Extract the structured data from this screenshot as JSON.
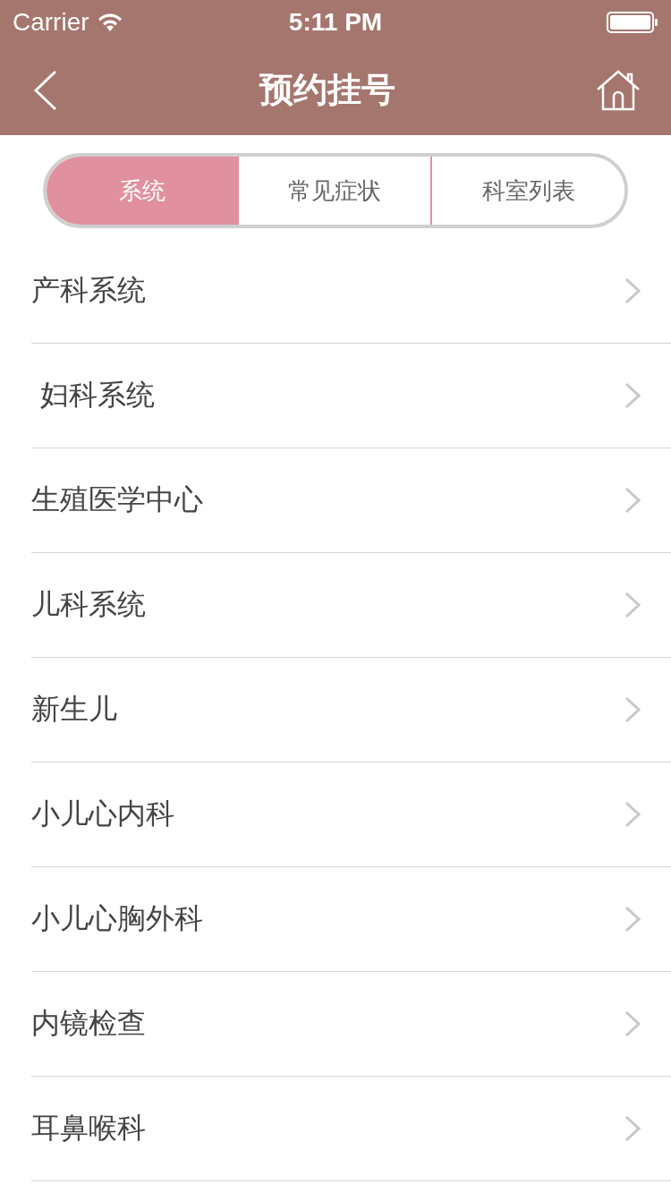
{
  "status_bar": {
    "carrier": "Carrier",
    "time": "5:11 PM"
  },
  "nav": {
    "title": "预约挂号"
  },
  "tabs": [
    {
      "label": "系统",
      "selected": true
    },
    {
      "label": "常见症状",
      "selected": false
    },
    {
      "label": "科室列表",
      "selected": false
    }
  ],
  "items": [
    {
      "label": "产科系统"
    },
    {
      "label": " 妇科系统"
    },
    {
      "label": "生殖医学中心"
    },
    {
      "label": "儿科系统"
    },
    {
      "label": "新生儿"
    },
    {
      "label": "小儿心内科"
    },
    {
      "label": "小儿心胸外科"
    },
    {
      "label": "内镜检查"
    },
    {
      "label": "耳鼻喉科"
    }
  ]
}
